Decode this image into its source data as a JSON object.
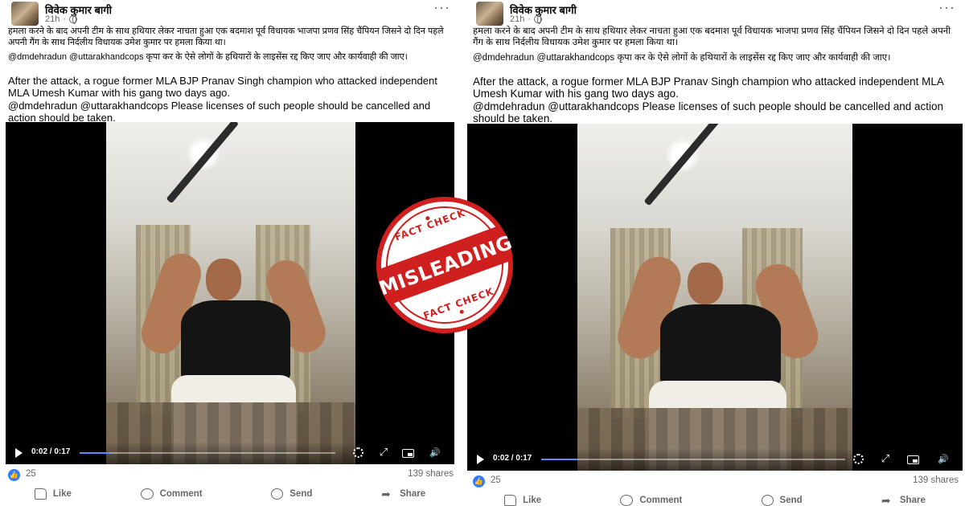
{
  "colors": {
    "stamp_red": "#cf1f1f",
    "meta_gray": "#65676b",
    "like_blue": "#2f7dff"
  },
  "posts": [
    {
      "author": "विवेक कुमार बागी",
      "time": "21h",
      "more_icon": "more-horizontal-icon",
      "hindi_1": "हमला करने के बाद अपनी टीम के साथ हथियार लेकर नाचता हुआ एक बदमाश पूर्व विधायक भाजपा प्रणव सिंह चैंपियन जिसने दो दिन पहले अपनी गैंग के साथ निर्दलीय विधायक उमेश कुमार पर हमला किया था।",
      "hindi_2": "@dmdehradun @uttarakhandcops कृपा कर के ऐसे लोगों के हथियारों के लाइसेंस रद्द किए जाए और कार्यवाही की जाए।",
      "english_1": "After the attack, a rogue former MLA BJP Pranav Singh champion who attacked independent MLA Umesh Kumar with his gang two days ago.",
      "english_2": "@dmdehradun @uttarakhandcops Please licenses of such people should be cancelled and action should be taken.",
      "video": {
        "time": "0:02 / 0:17",
        "progress": 0.12
      },
      "likes": "25",
      "shares": "139 shares",
      "actions": {
        "like": "Like",
        "comment": "Comment",
        "send": "Send",
        "share": "Share"
      }
    },
    {
      "author": "विवेक कुमार बागी",
      "time": "21h",
      "more_icon": "more-horizontal-icon",
      "hindi_1": "हमला करने के बाद अपनी टीम के साथ हथियार लेकर नाचता हुआ एक बदमाश पूर्व विधायक भाजपा प्रणव सिंह चैंपियन जिसने दो दिन पहले अपनी गैंग के साथ निर्दलीय विधायक उमेश कुमार पर हमला किया था।",
      "hindi_2": "@dmdehradun @uttarakhandcops कृपा कर के ऐसे लोगों के हथियारों के लाइसेंस रद्द किए जाए और कार्यवाही की जाए।",
      "english_1": "After the attack, a rogue former MLA BJP Pranav Singh champion who attacked independent MLA Umesh Kumar with his gang two days ago.",
      "english_2": "@dmdehradun @uttarakhandcops Please licenses of such people should be cancelled and action should be taken.",
      "video": {
        "time": "0:02 / 0:17",
        "progress": 0.12
      },
      "likes": "25",
      "shares": "139 shares",
      "actions": {
        "like": "Like",
        "comment": "Comment",
        "send": "Send",
        "share": "Share"
      }
    }
  ],
  "stamp": {
    "top": "FACT CHECK",
    "main": "MISLEADING",
    "bottom": "FACT CHECK"
  }
}
